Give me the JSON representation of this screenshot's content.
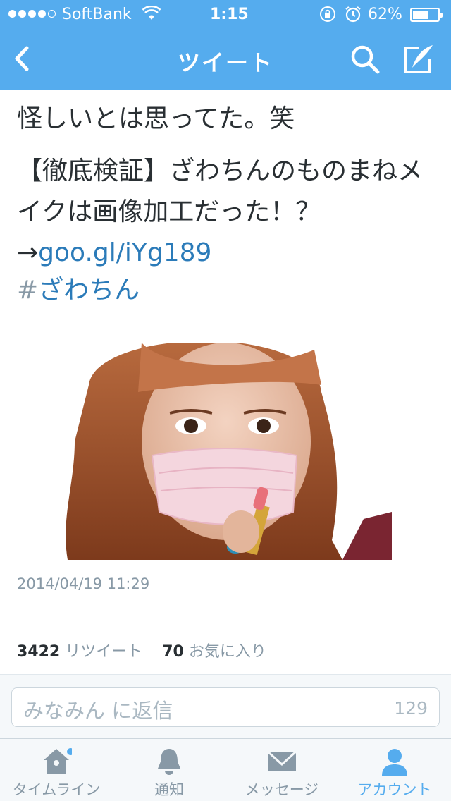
{
  "status_bar": {
    "carrier": "SoftBank",
    "time": "1:15",
    "battery_percent": "62%",
    "battery_level": 0.62,
    "signal_bars_filled": 4,
    "signal_bars_total": 5
  },
  "nav": {
    "title": "ツイート",
    "icons": [
      "chevron-left-icon",
      "search-icon",
      "compose-icon"
    ]
  },
  "tweet": {
    "line1": "怪しいとは思ってた。笑",
    "body": "【徹底検証】ざわちんのものまねメイクは画像加工だった！？",
    "arrow": "→",
    "link": "goo.gl/iYg189",
    "hashtag_symbol": "#",
    "hashtag": "ざわちん",
    "timestamp": "2014/04/19 11:29",
    "retweet_count": "3422",
    "retweet_label": "リツイート",
    "favorite_count": "70",
    "favorite_label": "お気に入り"
  },
  "reply": {
    "placeholder": "みなみん に返信",
    "chars_remaining": "129"
  },
  "tabbar": {
    "items": [
      {
        "label": "タイムライン",
        "icon": "home-icon",
        "badge": true
      },
      {
        "label": "通知",
        "icon": "bell-icon"
      },
      {
        "label": "メッセージ",
        "icon": "envelope-icon"
      },
      {
        "label": "アカウント",
        "icon": "person-icon",
        "active": true
      }
    ]
  },
  "colors": {
    "brand_blue": "#55acee",
    "link_blue": "#2b7bb9",
    "muted_gray": "#8899a6",
    "text": "#292f33"
  }
}
